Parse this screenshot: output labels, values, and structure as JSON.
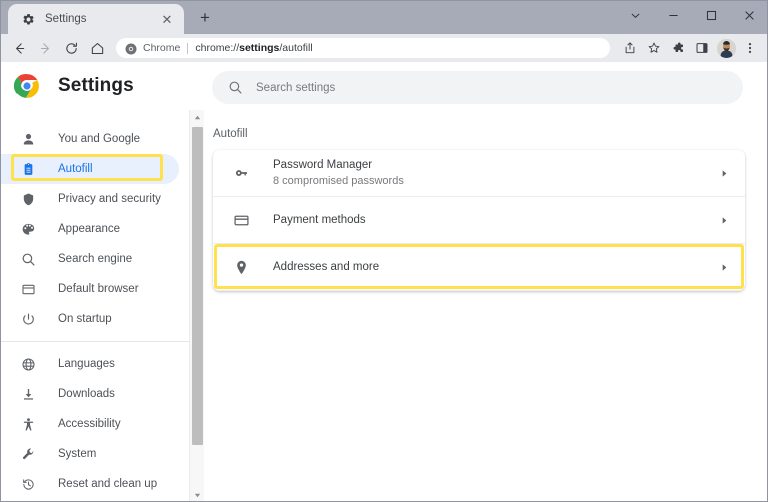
{
  "window": {
    "controls": [
      {
        "name": "chevron-down-icon",
        "label": "⌄"
      },
      {
        "name": "minimize-icon",
        "label": "—"
      },
      {
        "name": "maximize-icon",
        "label": "□"
      },
      {
        "name": "close-icon",
        "label": "✕"
      }
    ]
  },
  "tabstrip": {
    "tab": {
      "favicon": "gear-icon",
      "title": "Settings",
      "close_label": "✕"
    },
    "new_tab_label": "+"
  },
  "toolbar": {
    "back_icon": "back-arrow-icon",
    "forward_icon": "forward-arrow-icon",
    "reload_icon": "reload-icon",
    "home_icon": "home-icon",
    "omnibox": {
      "site_icon": "chrome-icon",
      "site_label": "Chrome",
      "url_prefix": "chrome://",
      "url_bold": "settings",
      "url_suffix": "/autofill",
      "full_url": "chrome://settings/autofill"
    },
    "actions": [
      {
        "name": "share-icon",
        "label": "share"
      },
      {
        "name": "bookmark-star-icon",
        "label": "star"
      },
      {
        "name": "extensions-puzzle-icon",
        "label": "puzzle"
      },
      {
        "name": "side-panel-icon",
        "label": "side panel"
      },
      {
        "name": "avatar",
        "label": "profile"
      },
      {
        "name": "chrome-menu-icon",
        "label": "⋮"
      }
    ]
  },
  "settings": {
    "logo": "chrome-logo",
    "title": "Settings",
    "search": {
      "icon": "search-icon",
      "placeholder": "Search settings"
    }
  },
  "sidebar": {
    "items": [
      {
        "label": "You and Google",
        "icon": "person-icon",
        "selected": false
      },
      {
        "label": "Autofill",
        "icon": "clipboard-icon",
        "selected": true
      },
      {
        "label": "Privacy and security",
        "icon": "shield-icon",
        "selected": false
      },
      {
        "label": "Appearance",
        "icon": "palette-icon",
        "selected": false
      },
      {
        "label": "Search engine",
        "icon": "search-icon",
        "selected": false
      },
      {
        "label": "Default browser",
        "icon": "browser-window-icon",
        "selected": false
      },
      {
        "label": "On startup",
        "icon": "power-icon",
        "selected": false
      },
      {
        "label": "Languages",
        "icon": "globe-icon",
        "selected": false
      },
      {
        "label": "Downloads",
        "icon": "download-icon",
        "selected": false
      },
      {
        "label": "Accessibility",
        "icon": "accessibility-icon",
        "selected": false
      },
      {
        "label": "System",
        "icon": "wrench-icon",
        "selected": false
      },
      {
        "label": "Reset and clean up",
        "icon": "history-restore-icon",
        "selected": false
      }
    ],
    "scrollbar": {
      "up_arrow": "▲",
      "down_arrow": "▼"
    }
  },
  "main": {
    "section_title": "Autofill",
    "rows": [
      {
        "title": "Password Manager",
        "subtitle": "8 compromised passwords",
        "icon": "key-icon",
        "chevron": "▸",
        "highlighted": false
      },
      {
        "title": "Payment methods",
        "subtitle": "",
        "icon": "credit-card-icon",
        "chevron": "▸",
        "highlighted": false
      },
      {
        "title": "Addresses and more",
        "subtitle": "",
        "icon": "location-pin-icon",
        "chevron": "▸",
        "highlighted": true
      }
    ]
  },
  "colors": {
    "titlebar": "#a7abb8",
    "toolbar": "#e8eaed",
    "accent_blue": "#1a73e8",
    "selected_bg": "#e8f0fe",
    "highlight_yellow": "#ffe14d",
    "text_primary": "#3c4043",
    "text_secondary": "#76797d"
  }
}
